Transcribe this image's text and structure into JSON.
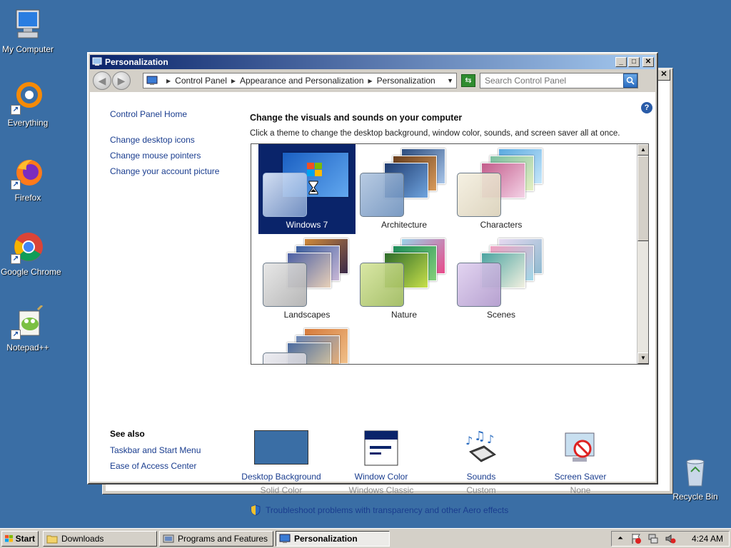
{
  "desktop": {
    "icons": [
      {
        "label": "My Computer"
      },
      {
        "label": "Everything"
      },
      {
        "label": "Firefox"
      },
      {
        "label": "Google Chrome"
      },
      {
        "label": "Notepad++"
      },
      {
        "label": "Recycle Bin"
      }
    ]
  },
  "window": {
    "title": "Personalization",
    "breadcrumb": [
      "Control Panel",
      "Appearance and Personalization",
      "Personalization"
    ],
    "search_placeholder": "Search Control Panel",
    "left_pane": {
      "home": "Control Panel Home",
      "links": [
        "Change desktop icons",
        "Change mouse pointers",
        "Change your account picture"
      ]
    },
    "see_also": {
      "heading": "See also",
      "links": [
        "Taskbar and Start Menu",
        "Ease of Access Center"
      ]
    },
    "heading": "Change the visuals and sounds on your computer",
    "subheading": "Click a theme to change the desktop background, window color, sounds, and screen saver all at once.",
    "themes": [
      {
        "name": "Windows 7",
        "selected": true
      },
      {
        "name": "Architecture",
        "selected": false
      },
      {
        "name": "Characters",
        "selected": false
      },
      {
        "name": "Landscapes",
        "selected": false
      },
      {
        "name": "Nature",
        "selected": false
      },
      {
        "name": "Scenes",
        "selected": false
      },
      {
        "name": "",
        "selected": false
      }
    ],
    "bottom_items": [
      {
        "label": "Desktop Background",
        "sub": "Solid Color"
      },
      {
        "label": "Window Color",
        "sub": "Windows Classic"
      },
      {
        "label": "Sounds",
        "sub": "Custom"
      },
      {
        "label": "Screen Saver",
        "sub": "None"
      }
    ],
    "troubleshoot": "Troubleshoot problems with transparency and other Aero effects",
    "help_label": "?"
  },
  "taskbar": {
    "start": "Start",
    "tasks": [
      {
        "label": "Downloads",
        "active": false
      },
      {
        "label": "Programs and Features",
        "active": false
      },
      {
        "label": "Personalization",
        "active": true
      }
    ],
    "clock": "4:24 AM"
  },
  "colors": {
    "desktop": "#3a6ea5",
    "title_active_start": "#0a246a",
    "title_active_end": "#a6caf0",
    "selected_theme": "#0a246a",
    "link": "#1a3d8f"
  }
}
